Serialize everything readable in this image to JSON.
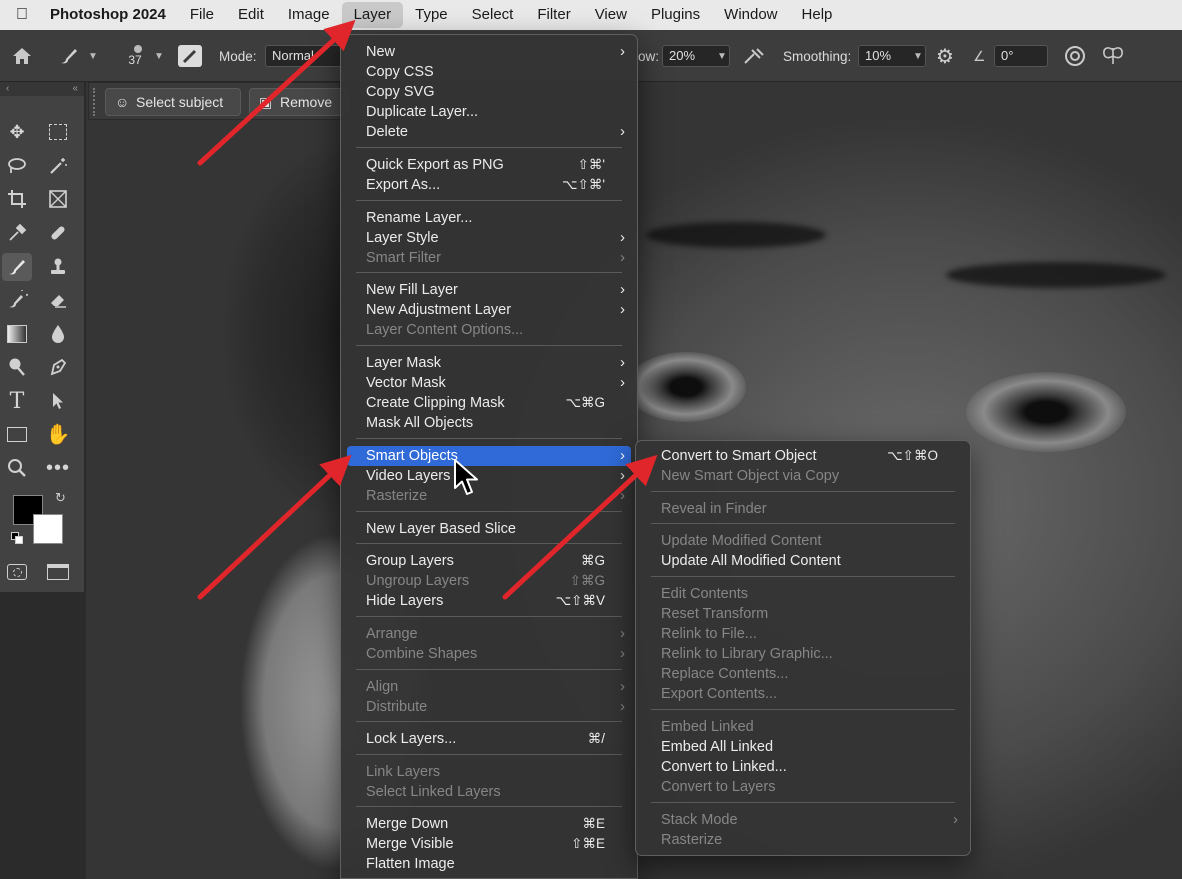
{
  "menubar": {
    "app_name": "Photoshop 2024",
    "items": [
      "File",
      "Edit",
      "Image",
      "Layer",
      "Type",
      "Select",
      "Filter",
      "View",
      "Plugins",
      "Window",
      "Help"
    ]
  },
  "options_bar": {
    "brush_size": "37",
    "mode_label": "Mode:",
    "mode_value": "Normal",
    "flow_label": "ow:",
    "flow_value": "20%",
    "smoothing_label": "Smoothing:",
    "smoothing_value": "10%",
    "angle_value": "0°"
  },
  "task_bar": {
    "select_subject": "Select subject",
    "remove": "Remove"
  },
  "layer_menu": {
    "items": [
      {
        "label": "New",
        "shortcut": "",
        "arrow": true,
        "disabled": false
      },
      {
        "label": "Copy CSS",
        "shortcut": "",
        "arrow": false,
        "disabled": false
      },
      {
        "label": "Copy SVG",
        "shortcut": "",
        "arrow": false,
        "disabled": false
      },
      {
        "label": "Duplicate Layer...",
        "shortcut": "",
        "arrow": false,
        "disabled": false
      },
      {
        "label": "Delete",
        "shortcut": "",
        "arrow": true,
        "disabled": false
      },
      {
        "label": "Quick Export as PNG",
        "shortcut": "⇧⌘'",
        "arrow": false,
        "disabled": false
      },
      {
        "label": "Export As...",
        "shortcut": "⌥⇧⌘'",
        "arrow": false,
        "disabled": false
      },
      {
        "label": "Rename Layer...",
        "shortcut": "",
        "arrow": false,
        "disabled": false
      },
      {
        "label": "Layer Style",
        "shortcut": "",
        "arrow": true,
        "disabled": false
      },
      {
        "label": "Smart Filter",
        "shortcut": "",
        "arrow": true,
        "disabled": true
      },
      {
        "label": "New Fill Layer",
        "shortcut": "",
        "arrow": true,
        "disabled": false
      },
      {
        "label": "New Adjustment Layer",
        "shortcut": "",
        "arrow": true,
        "disabled": false
      },
      {
        "label": "Layer Content Options...",
        "shortcut": "",
        "arrow": false,
        "disabled": true
      },
      {
        "label": "Layer Mask",
        "shortcut": "",
        "arrow": true,
        "disabled": false
      },
      {
        "label": "Vector Mask",
        "shortcut": "",
        "arrow": true,
        "disabled": false
      },
      {
        "label": "Create Clipping Mask",
        "shortcut": "⌥⌘G",
        "arrow": false,
        "disabled": false
      },
      {
        "label": "Mask All Objects",
        "shortcut": "",
        "arrow": false,
        "disabled": false
      },
      {
        "label": "Smart Objects",
        "shortcut": "",
        "arrow": true,
        "disabled": false,
        "highlighted": true
      },
      {
        "label": "Video Layers",
        "shortcut": "",
        "arrow": true,
        "disabled": false
      },
      {
        "label": "Rasterize",
        "shortcut": "",
        "arrow": true,
        "disabled": true
      },
      {
        "label": "New Layer Based Slice",
        "shortcut": "",
        "arrow": false,
        "disabled": false
      },
      {
        "label": "Group Layers",
        "shortcut": "⌘G",
        "arrow": false,
        "disabled": false
      },
      {
        "label": "Ungroup Layers",
        "shortcut": "⇧⌘G",
        "arrow": false,
        "disabled": true
      },
      {
        "label": "Hide Layers",
        "shortcut": "⌥⇧⌘V",
        "arrow": false,
        "disabled": false
      },
      {
        "label": "Arrange",
        "shortcut": "",
        "arrow": true,
        "disabled": true
      },
      {
        "label": "Combine Shapes",
        "shortcut": "",
        "arrow": true,
        "disabled": true
      },
      {
        "label": "Align",
        "shortcut": "",
        "arrow": true,
        "disabled": true
      },
      {
        "label": "Distribute",
        "shortcut": "",
        "arrow": true,
        "disabled": true
      },
      {
        "label": "Lock Layers...",
        "shortcut": "⌘/",
        "arrow": false,
        "disabled": false
      },
      {
        "label": "Link Layers",
        "shortcut": "",
        "arrow": false,
        "disabled": true
      },
      {
        "label": "Select Linked Layers",
        "shortcut": "",
        "arrow": false,
        "disabled": true
      },
      {
        "label": "Merge Down",
        "shortcut": "⌘E",
        "arrow": false,
        "disabled": false
      },
      {
        "label": "Merge Visible",
        "shortcut": "⇧⌘E",
        "arrow": false,
        "disabled": false
      },
      {
        "label": "Flatten Image",
        "shortcut": "",
        "arrow": false,
        "disabled": false
      }
    ]
  },
  "smart_objects_submenu": {
    "items": [
      {
        "label": "Convert to Smart Object",
        "shortcut": "⌥⇧⌘O",
        "arrow": false,
        "disabled": false
      },
      {
        "label": "New Smart Object via Copy",
        "shortcut": "",
        "arrow": false,
        "disabled": true
      },
      {
        "label": "Reveal in Finder",
        "shortcut": "",
        "arrow": false,
        "disabled": true
      },
      {
        "label": "Update Modified Content",
        "shortcut": "",
        "arrow": false,
        "disabled": true
      },
      {
        "label": "Update All Modified Content",
        "shortcut": "",
        "arrow": false,
        "disabled": false
      },
      {
        "label": "Edit Contents",
        "shortcut": "",
        "arrow": false,
        "disabled": true
      },
      {
        "label": "Reset Transform",
        "shortcut": "",
        "arrow": false,
        "disabled": true
      },
      {
        "label": "Relink to File...",
        "shortcut": "",
        "arrow": false,
        "disabled": true
      },
      {
        "label": "Relink to Library Graphic...",
        "shortcut": "",
        "arrow": false,
        "disabled": true
      },
      {
        "label": "Replace Contents...",
        "shortcut": "",
        "arrow": false,
        "disabled": true
      },
      {
        "label": "Export Contents...",
        "shortcut": "",
        "arrow": false,
        "disabled": true
      },
      {
        "label": "Embed Linked",
        "shortcut": "",
        "arrow": false,
        "disabled": true
      },
      {
        "label": "Embed All Linked",
        "shortcut": "",
        "arrow": false,
        "disabled": false
      },
      {
        "label": "Convert to Linked...",
        "shortcut": "",
        "arrow": false,
        "disabled": false
      },
      {
        "label": "Convert to Layers",
        "shortcut": "",
        "arrow": false,
        "disabled": true
      },
      {
        "label": "Stack Mode",
        "shortcut": "",
        "arrow": true,
        "disabled": true
      },
      {
        "label": "Rasterize",
        "shortcut": "",
        "arrow": false,
        "disabled": true
      }
    ]
  },
  "colors": {
    "highlight": "#2f6ad8",
    "annotation_arrow": "#e0262a"
  }
}
